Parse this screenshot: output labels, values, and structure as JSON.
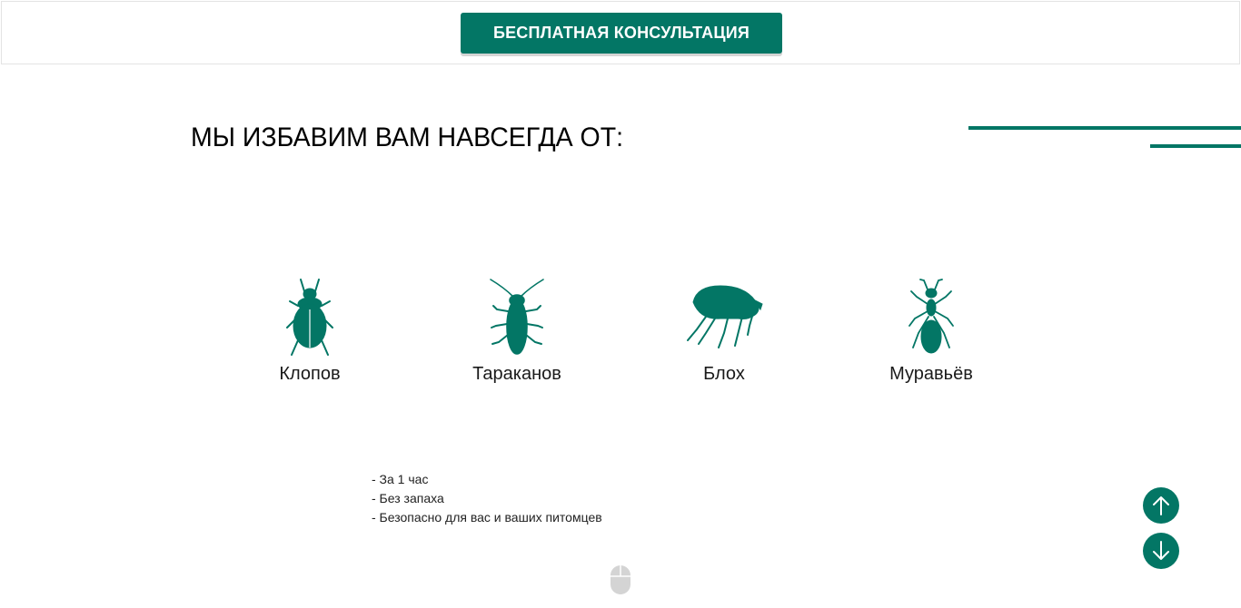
{
  "header": {
    "cta_label": "БЕСПЛАТНАЯ КОНСУЛЬТАЦИЯ"
  },
  "main": {
    "heading": "МЫ ИЗБАВИМ ВАМ НАВСЕГДА ОТ:",
    "pests": [
      {
        "label": "Клопов",
        "icon": "bedbug-icon"
      },
      {
        "label": "Тараканов",
        "icon": "cockroach-icon"
      },
      {
        "label": "Блох",
        "icon": "flea-icon"
      },
      {
        "label": "Муравьёв",
        "icon": "ant-icon"
      }
    ],
    "benefits": [
      "- За 1 час",
      "- Без запаха",
      "- Безопасно для вас и ваших питомцев"
    ]
  },
  "navigation": {
    "up_icon": "arrow-up-icon",
    "down_icon": "arrow-down-icon",
    "scroll_icon": "mouse-scroll-icon"
  },
  "colors": {
    "accent": "#037665",
    "text": "#111111",
    "muted": "#cccccc"
  }
}
